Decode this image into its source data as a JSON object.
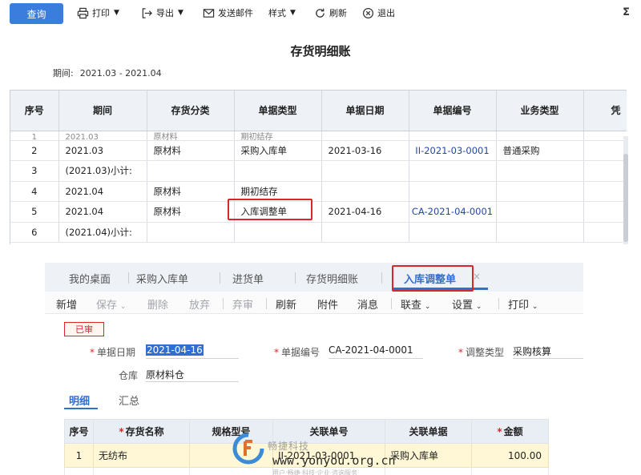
{
  "toolbar": {
    "query_label": "查询",
    "print_label": "打印",
    "export_label": "导出",
    "email_label": "发送邮件",
    "style_label": "样式",
    "refresh_label": "刷新",
    "exit_label": "退出",
    "edge_glyph": "ⵉ"
  },
  "report": {
    "title": "存货明细账",
    "period_label": "期间:",
    "period_value": "2021.03 - 2021.04",
    "columns": [
      "序号",
      "期间",
      "存货分类",
      "单据类型",
      "单据日期",
      "单据编号",
      "业务类型",
      "凭"
    ],
    "partial_row": {
      "no": "1",
      "period": "2021.03",
      "category": "原材料",
      "doc_type": "期初结存"
    },
    "rows": [
      {
        "no": "2",
        "period": "2021.03",
        "category": "原材料",
        "doc_type": "采购入库单",
        "doc_date": "2021-03-16",
        "doc_no": "II-2021-03-0001",
        "biz_type": "普通采购"
      },
      {
        "no": "3",
        "period": "(2021.03)小计:",
        "category": "",
        "doc_type": "",
        "doc_date": "",
        "doc_no": "",
        "biz_type": ""
      },
      {
        "no": "4",
        "period": "2021.04",
        "category": "原材料",
        "doc_type": "期初结存",
        "doc_date": "",
        "doc_no": "",
        "biz_type": ""
      },
      {
        "no": "5",
        "period": "2021.04",
        "category": "原材料",
        "doc_type": "入库调整单",
        "doc_date": "2021-04-16",
        "doc_no": "CA-2021-04-0001",
        "biz_type": ""
      },
      {
        "no": "6",
        "period": "(2021.04)小计:",
        "category": "",
        "doc_type": "",
        "doc_date": "",
        "doc_no": "",
        "biz_type": ""
      }
    ]
  },
  "tabs": [
    "我的桌面",
    "采购入库单",
    "进货单",
    "存货明细账",
    "入库调整单"
  ],
  "tab_close": "×",
  "actions": {
    "new": "新增",
    "save": "保存",
    "delete": "删除",
    "abandon": "放弃",
    "unaudit": "弃审",
    "refresh": "刷新",
    "attachment": "附件",
    "message": "消息",
    "linked_query": "联查",
    "settings": "设置",
    "print": "打印"
  },
  "form": {
    "status_stamp": "已审",
    "doc_date_label": "单据日期",
    "doc_date_value": "2021-04-16",
    "doc_no_label": "单据编号",
    "doc_no_value": "CA-2021-04-0001",
    "adjust_type_label": "调整类型",
    "adjust_type_value": "采购核算",
    "warehouse_label": "仓库",
    "warehouse_value": "原材料仓",
    "required_mark": "*"
  },
  "subtabs": [
    "明细",
    "汇总"
  ],
  "detail": {
    "columns": [
      "序号",
      "存货名称",
      "规格型号",
      "关联单号",
      "关联单据",
      "金额"
    ],
    "rows": [
      {
        "no": "1",
        "name": "无纺布",
        "spec": "",
        "ref_no": "II-2021-03-0001",
        "ref_doc": "采购入库单",
        "amount": "100.00"
      }
    ]
  },
  "watermark": {
    "brand": "畅捷科技",
    "url": "www.yonyou.org.cn",
    "small_text": "用户·畅捷·科技·企业·咨询服务"
  },
  "colors": {
    "primary": "#3b7ddd",
    "highlight_red": "#d9262b",
    "link_blue": "#2346a8",
    "selected_row": "#fff7d6"
  }
}
